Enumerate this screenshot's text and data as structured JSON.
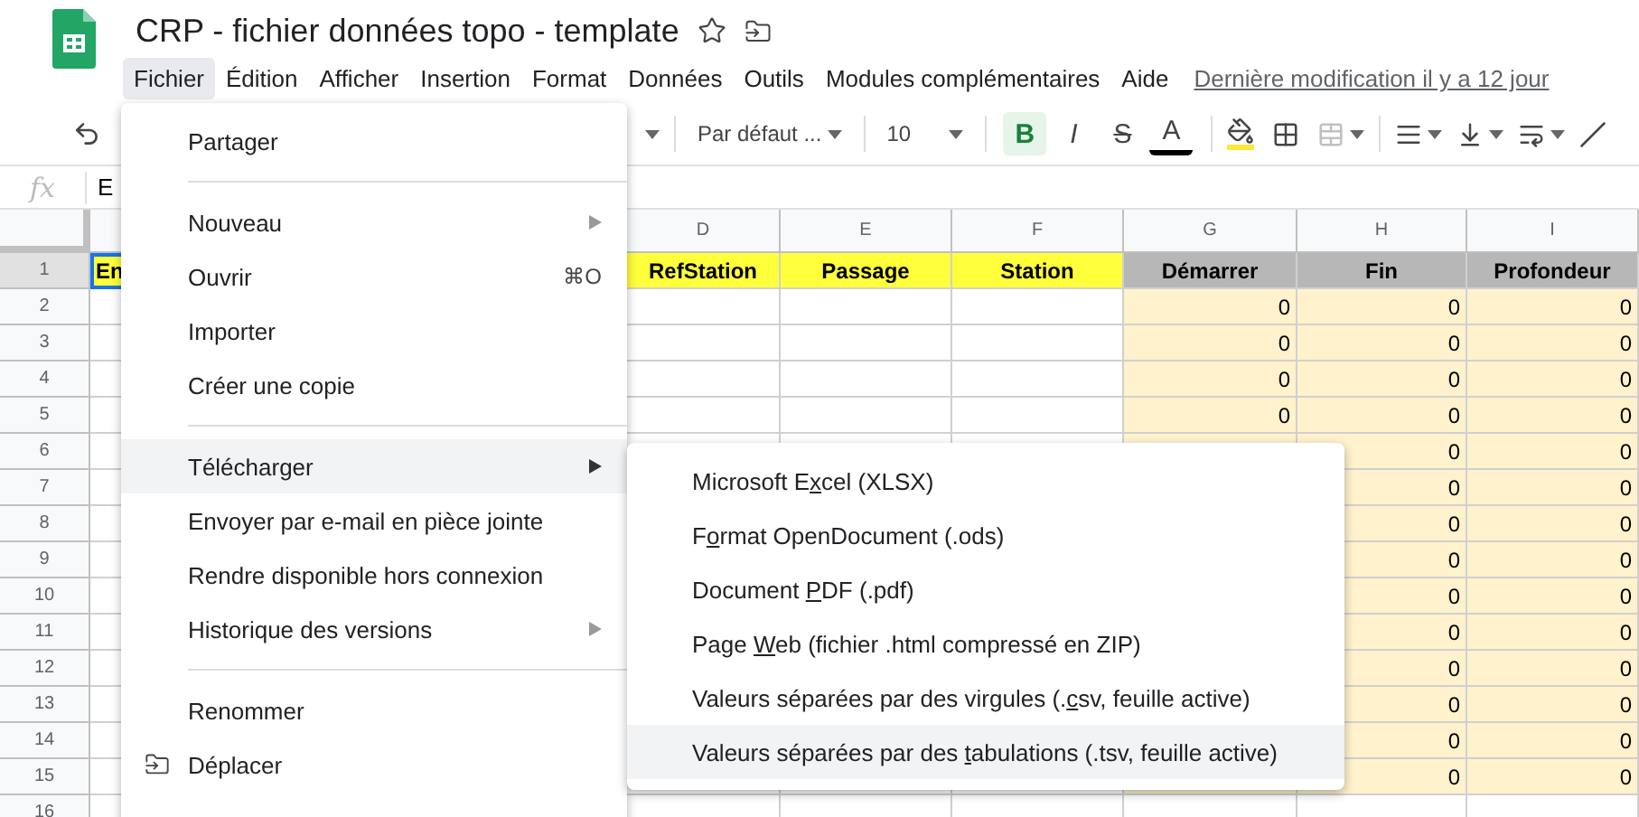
{
  "document": {
    "title": "CRP - fichier données topo - template",
    "last_modified": "Dernière modification il y a 12 jour"
  },
  "menu_bar": [
    {
      "label": "Fichier",
      "selected": true
    },
    {
      "label": "Édition",
      "selected": false
    },
    {
      "label": "Afficher",
      "selected": false
    },
    {
      "label": "Insertion",
      "selected": false
    },
    {
      "label": "Format",
      "selected": false
    },
    {
      "label": "Données",
      "selected": false
    },
    {
      "label": "Outils",
      "selected": false
    },
    {
      "label": "Modules complémentaires",
      "selected": false
    },
    {
      "label": "Aide",
      "selected": false
    }
  ],
  "toolbar": {
    "font": "Par défaut ...",
    "font_size": "10",
    "format_buttons": [
      {
        "kind": "bold",
        "label": "B",
        "active": true
      },
      {
        "kind": "italic",
        "label": "I",
        "active": false
      },
      {
        "kind": "strike",
        "label": "S",
        "active": false
      },
      {
        "kind": "color",
        "label": "A",
        "active": false
      }
    ]
  },
  "formula_bar": {
    "label": "fx",
    "value": "E"
  },
  "sheet": {
    "columns": [
      {
        "letter": "D",
        "shaded": false
      },
      {
        "letter": "E",
        "shaded": false
      },
      {
        "letter": "F",
        "shaded": false
      },
      {
        "letter": "G",
        "shaded": true
      },
      {
        "letter": "H",
        "shaded": true
      },
      {
        "letter": "I",
        "shaded": true
      }
    ],
    "header_row": {
      "number": "1",
      "first_cell": {
        "text": "En",
        "selected": true
      },
      "cells": [
        {
          "text": "RefStation",
          "color": "#ffff3b"
        },
        {
          "text": "Passage",
          "color": "#ffff3b"
        },
        {
          "text": "Station",
          "color": "#ffff3b"
        },
        {
          "text": "Démarrer",
          "color": "#b7b7b7"
        },
        {
          "text": "Fin",
          "color": "#b7b7b7"
        },
        {
          "text": "Profondeur",
          "color": "#b7b7b7"
        }
      ]
    },
    "rows": [
      {
        "number": "2",
        "shaded": true,
        "values": {
          "G": "0",
          "H": "0",
          "I": "0"
        }
      },
      {
        "number": "3",
        "shaded": true,
        "values": {
          "G": "0",
          "H": "0",
          "I": "0"
        }
      },
      {
        "number": "4",
        "shaded": true,
        "values": {
          "G": "0",
          "H": "0",
          "I": "0"
        }
      },
      {
        "number": "5",
        "shaded": true,
        "values": {
          "G": "0",
          "H": "0",
          "I": "0"
        }
      },
      {
        "number": "6",
        "shaded": true,
        "values": {
          "H": "0",
          "I": "0"
        }
      },
      {
        "number": "7",
        "shaded": true,
        "values": {
          "H": "0",
          "I": "0"
        }
      },
      {
        "number": "8",
        "shaded": true,
        "values": {
          "H": "0",
          "I": "0"
        }
      },
      {
        "number": "9",
        "shaded": true,
        "values": {
          "H": "0",
          "I": "0"
        }
      },
      {
        "number": "10",
        "shaded": true,
        "values": {
          "H": "0",
          "I": "0"
        }
      },
      {
        "number": "11",
        "shaded": true,
        "values": {
          "H": "0",
          "I": "0"
        }
      },
      {
        "number": "12",
        "shaded": true,
        "values": {
          "H": "0",
          "I": "0"
        }
      },
      {
        "number": "13",
        "shaded": true,
        "values": {
          "H": "0",
          "I": "0"
        }
      },
      {
        "number": "14",
        "shaded": true,
        "values": {
          "H": "0",
          "I": "0"
        }
      },
      {
        "number": "15",
        "shaded": true,
        "values": {
          "H": "0",
          "I": "0"
        }
      },
      {
        "number": "16",
        "shaded": false,
        "values": {}
      }
    ]
  },
  "file_menu": [
    {
      "kind": "item",
      "label": "Partager",
      "selected": false,
      "submenu": false
    },
    {
      "kind": "divider"
    },
    {
      "kind": "item",
      "label": "Nouveau",
      "selected": false,
      "submenu": true
    },
    {
      "kind": "item",
      "label": "Ouvrir",
      "selected": false,
      "submenu": false,
      "shortcut": "⌘O"
    },
    {
      "kind": "item",
      "label": "Importer",
      "selected": false,
      "submenu": false
    },
    {
      "kind": "item",
      "label": "Créer une copie",
      "selected": false,
      "submenu": false
    },
    {
      "kind": "divider"
    },
    {
      "kind": "item",
      "label": "Télécharger",
      "selected": true,
      "submenu": true
    },
    {
      "kind": "item",
      "label": "Envoyer par e-mail en pièce jointe",
      "selected": false,
      "submenu": false
    },
    {
      "kind": "item",
      "label": "Rendre disponible hors connexion",
      "selected": false,
      "submenu": false
    },
    {
      "kind": "item",
      "label": "Historique des versions",
      "selected": false,
      "submenu": true
    },
    {
      "kind": "divider"
    },
    {
      "kind": "item",
      "label": "Renommer",
      "selected": false,
      "submenu": false
    },
    {
      "kind": "item",
      "label": "Déplacer",
      "selected": false,
      "submenu": false,
      "has_icon": true
    }
  ],
  "download_menu": [
    {
      "before": "Microsoft E",
      "key": "x",
      "after": "cel (XLSX)",
      "selected": false
    },
    {
      "before": "F",
      "key": "o",
      "after": "rmat OpenDocument (.ods)",
      "selected": false
    },
    {
      "before": "Document ",
      "key": "P",
      "after": "DF (.pdf)",
      "selected": false
    },
    {
      "before": "Page ",
      "key": "W",
      "after": "eb (fichier .html compressé en ZIP)",
      "selected": false
    },
    {
      "before": "Valeurs séparées par des virgules (.",
      "key": "c",
      "after": "sv, feuille active)",
      "selected": false
    },
    {
      "before": "Valeurs séparées par des ",
      "key": "t",
      "after": "abulations (.tsv, feuille active)",
      "selected": true
    }
  ]
}
